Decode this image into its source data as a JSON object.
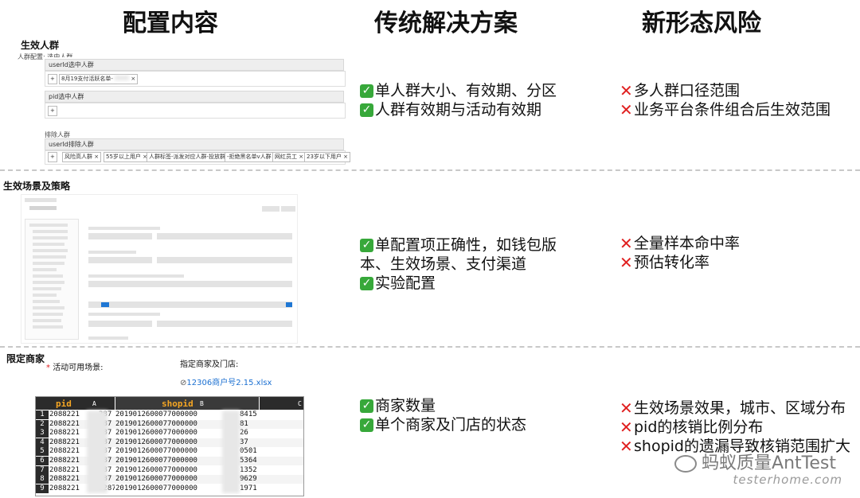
{
  "headers": {
    "config": "配置内容",
    "traditional": "传统解决方案",
    "new_risk": "新形态风险"
  },
  "section1": {
    "title": "生效人群",
    "crowd_config_label": "人群配置:",
    "crowd_config_value": "选中人群",
    "userid_label": "userId选中人群",
    "userid_tag": "8月19支付活跃名单-",
    "pid_label": "pid选中人群",
    "exclude_label": "排除人群",
    "userid_exclude_label": "userId排除人群",
    "exclude_tags": [
      "风险高人群 ×",
      "55岁以上用户 ×",
      "人群标签-派发对应人群-投放群 ×",
      "-拒绝黑名单v人群 ×",
      "网红员工 ×",
      "23岁以下用户 ×"
    ],
    "traditional": [
      "单人群大小、有效期、分区",
      "人群有效期与活动有效期"
    ],
    "risks": [
      "多人群口径范围",
      "业务平台条件组合后生效范围"
    ]
  },
  "section2": {
    "title": "生效场景及策略",
    "traditional": [
      "单配置项正确性，如钱包版",
      "本、生效场景、支付渠道",
      "实验配置"
    ],
    "risks": [
      "全量样本命中率",
      "预估转化率"
    ]
  },
  "section3": {
    "title": "限定商家",
    "required_mark": "*",
    "scene_label": "活动可用场景:",
    "merchant_label": "指定商家及门店:",
    "file_name": "12306商户号2.15.xlsx",
    "sheet": {
      "col_a_header": "pid",
      "col_a_letter": "A",
      "col_b_header": "shopid",
      "col_b_letter": "B",
      "rows": [
        {
          "n": "1",
          "a": "2088221",
          "a_end": "287",
          "b": "2019012600077000000",
          "b_end": "8415"
        },
        {
          "n": "2",
          "a": "2088221",
          "a_end": "287",
          "b": "2019012600077000000",
          "b_end": "81"
        },
        {
          "n": "3",
          "a": "2088221",
          "a_end": "287",
          "b": "2019012600077000000",
          "b_end": "26"
        },
        {
          "n": "4",
          "a": "2088221",
          "a_end": "287",
          "b": "2019012600077000000",
          "b_end": "37"
        },
        {
          "n": "5",
          "a": "2088221",
          "a_end": "287",
          "b": "2019012600077000000",
          "b_end": "0501"
        },
        {
          "n": "6",
          "a": "2088221",
          "a_end": "287",
          "b": "2019012600077000000",
          "b_end": "5364"
        },
        {
          "n": "7",
          "a": "2088221",
          "a_end": "287",
          "b": "2019012600077000000",
          "b_end": "1352"
        },
        {
          "n": "8",
          "a": "2088221",
          "a_end": "287",
          "b": "2019012600077000000",
          "b_end": "9629"
        },
        {
          "n": "9",
          "a": "2088221",
          "a_end": "3287",
          "b": "2019012600077000000",
          "b_end": "1971"
        }
      ]
    },
    "traditional": [
      "商家数量",
      "单个商家及门店的状态"
    ],
    "risks": [
      "生效场景效果，城市、区域分布",
      "pid的核销比例分布",
      "shopid的遗漏导致核销范围扩大"
    ]
  },
  "watermark": {
    "brand": "蚂蚁质量AntTest",
    "site": "testerhome.com"
  },
  "colors": {
    "check_green": "#37a83a",
    "cross_red": "#e02020",
    "link_blue": "#1a6fd1",
    "sheet_header_dark": "#2b2b2b"
  }
}
